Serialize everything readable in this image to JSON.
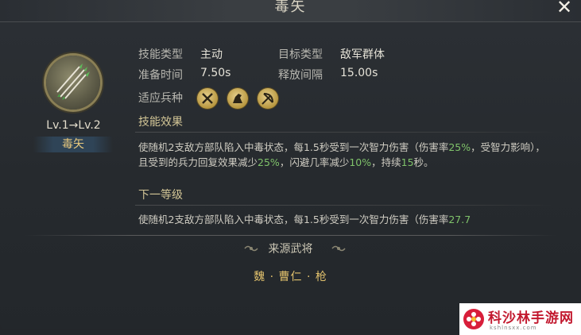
{
  "dialog": {
    "title": "毒矢"
  },
  "skill": {
    "level_text": "Lv.1→Lv.2",
    "name": "毒矢",
    "icon": "poison-arrow-icon"
  },
  "info": {
    "type_label": "技能类型",
    "type_value": "主动",
    "target_label": "目标类型",
    "target_value": "敌军群体",
    "prep_label": "准备时间",
    "prep_value": "7.50s",
    "interval_label": "释放间隔",
    "interval_value": "15.00s",
    "troop_label": "适应兵种",
    "troop_icons": [
      "infantry-icon",
      "cavalry-icon",
      "archer-icon"
    ]
  },
  "effect": {
    "title": "技能效果",
    "parts": [
      "使随机2支敌方部队陷入中毒状态，每1.5秒受到一次智力伤害（伤害率",
      "25%",
      "，受智力影响），且受到的兵力回复效果减少",
      "25%",
      "，闪避几率减少",
      "10%",
      "，持续",
      "15",
      "秒。"
    ]
  },
  "next": {
    "title": "下一等级",
    "parts": [
      "使随机2支敌方部队陷入中毒状态，每1.5秒受到一次智力伤害（伤害率",
      "27.7"
    ]
  },
  "source": {
    "title": "来源武将",
    "value": "魏 · 曹仁 · 枪"
  },
  "watermark": {
    "text": "科沙林手游网",
    "sub": "kshlnsxx.com"
  },
  "colors": {
    "highlight": "#7fc26a",
    "gold": "#e0c06c",
    "watermark_red": "#c2182e"
  }
}
